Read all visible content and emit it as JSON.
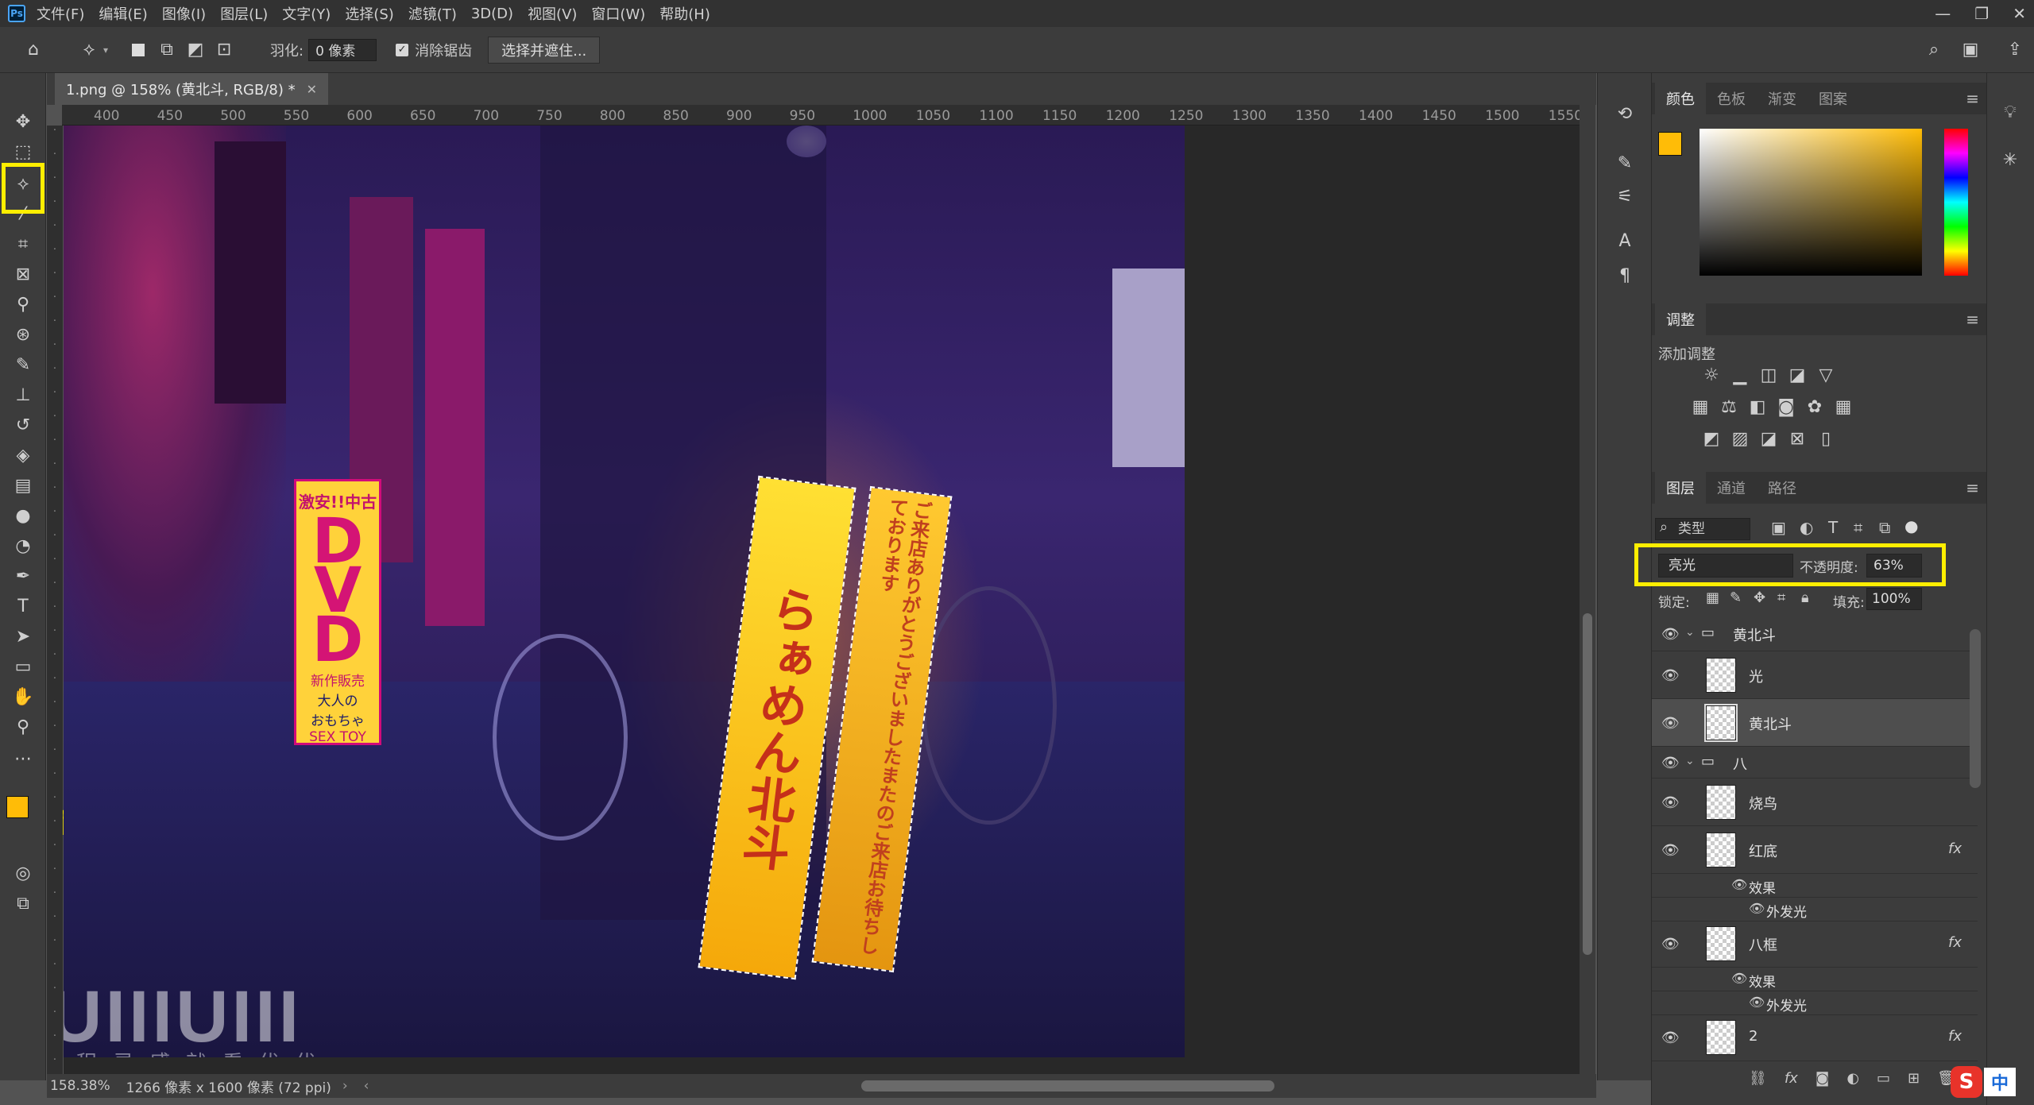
{
  "menu": [
    "文件(F)",
    "编辑(E)",
    "图像(I)",
    "图层(L)",
    "文字(Y)",
    "选择(S)",
    "滤镜(T)",
    "3D(D)",
    "视图(V)",
    "窗口(W)",
    "帮助(H)"
  ],
  "app_badge": "Ps",
  "options": {
    "feather_label": "羽化:",
    "feather_value": "0 像素",
    "antialias_label": "消除锯齿",
    "select_mask_button": "选择并遮住..."
  },
  "document": {
    "tab_title": "1.png @ 158% (黄北斗, RGB/8) *",
    "zoom": "158.38%",
    "dimensions": "1266 像素 x 1600 像素 (72 ppi)"
  },
  "ruler_h": [
    "400",
    "450",
    "500",
    "550",
    "600",
    "650",
    "700",
    "750",
    "800",
    "850",
    "900",
    "950",
    "1000",
    "1050",
    "1100",
    "1150",
    "1200",
    "1250",
    "1300",
    "1350",
    "1400",
    "1450",
    "1500",
    "1550"
  ],
  "annotation": {
    "color_hex": "ffbc07",
    "highlight_color": "#ffee00"
  },
  "colors": {
    "foreground": "#ffbc07",
    "background": "#ffffff"
  },
  "watermark": {
    "logo": "UIIIUIII",
    "tagline": "教程灵感就看优优"
  },
  "photo_signs": {
    "ramen_main": "らぁめん北斗",
    "ramen_side": "ご来店ありがとうございましたまたのご来店お待ちしております",
    "dvd_sign": "激安!!中古",
    "dvd_text": "DVD",
    "dvd_sub1": "新作販売",
    "dvd_sub2": "大人の",
    "dvd_sub3": "おもちゃ",
    "dvd_sub4": "SEX TOY"
  },
  "color_panel": {
    "tabs": [
      "颜色",
      "色板",
      "渐变",
      "图案"
    ]
  },
  "adjust_panel": {
    "title": "调整",
    "subtitle": "添加调整"
  },
  "layers_panel": {
    "tabs": [
      "图层",
      "通道",
      "路径"
    ],
    "filter_label": "类型",
    "blend_mode": "亮光",
    "opacity_label": "不透明度:",
    "opacity_value": "63%",
    "lock_label": "锁定:",
    "fill_label": "填充:",
    "fill_value": "100%",
    "layers": [
      {
        "name": "黄北斗",
        "type": "group"
      },
      {
        "name": "光",
        "type": "layer"
      },
      {
        "name": "黄北斗",
        "type": "layer"
      },
      {
        "name": "八",
        "type": "group"
      },
      {
        "name": "烧鸟",
        "type": "layer"
      },
      {
        "name": "红底",
        "type": "layer",
        "fx": "fx"
      },
      {
        "name": "效果",
        "type": "effect"
      },
      {
        "name": "外发光",
        "type": "effect"
      },
      {
        "name": "八框",
        "type": "layer",
        "fx": "fx"
      },
      {
        "name": "效果",
        "type": "effect"
      },
      {
        "name": "外发光",
        "type": "effect"
      },
      {
        "name": "2",
        "type": "layer",
        "fx": "fx"
      }
    ]
  },
  "ime": {
    "label": "中"
  }
}
